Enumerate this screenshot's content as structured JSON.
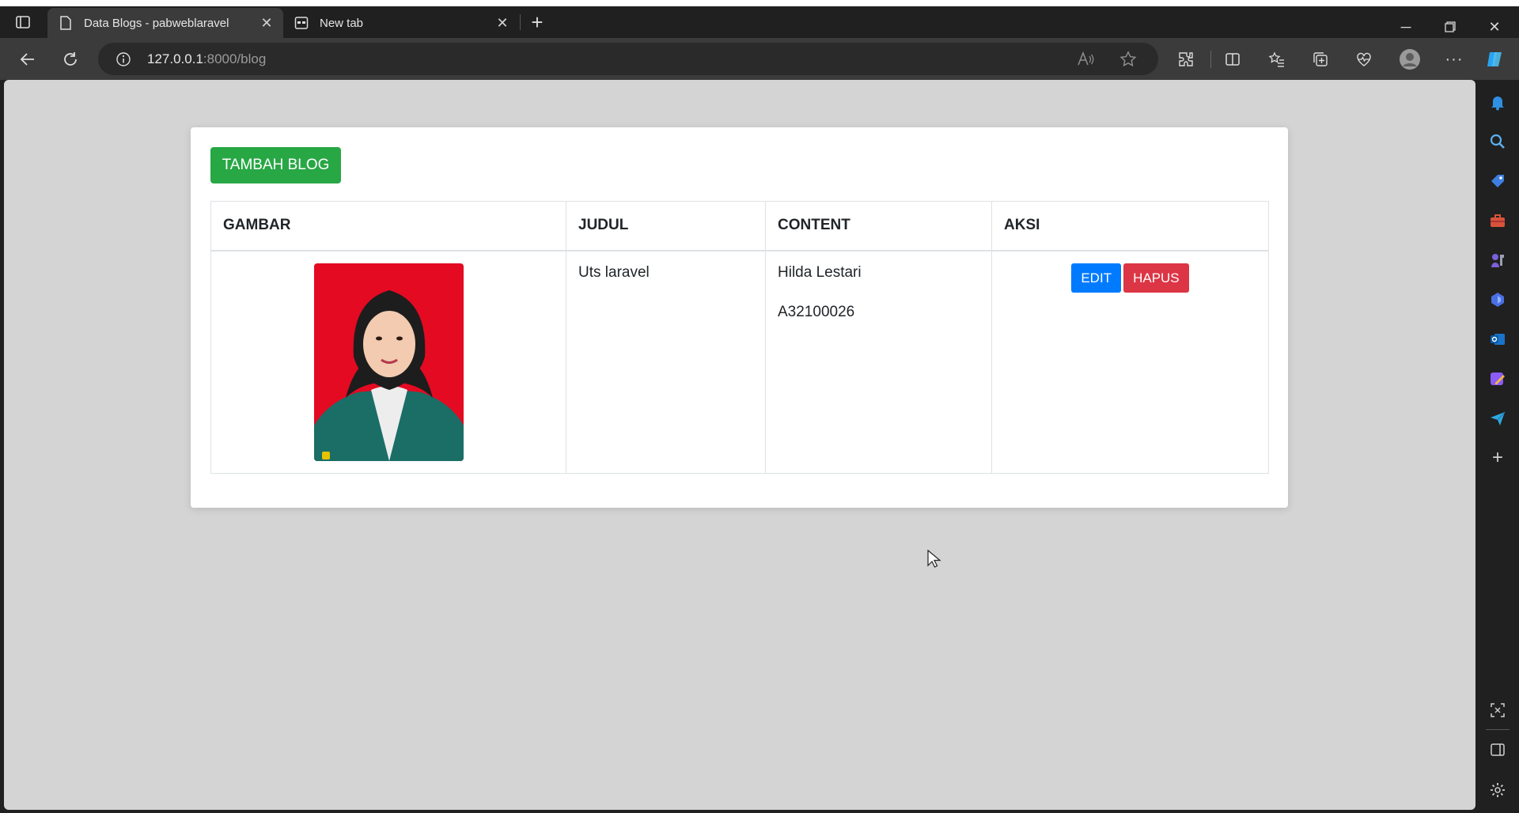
{
  "browser": {
    "tabs": [
      {
        "label": "Data Blogs - pabweblaravel",
        "active": true
      },
      {
        "label": "New tab",
        "active": false
      }
    ],
    "address": {
      "host": "127.0.0.1",
      "path": ":8000/blog"
    }
  },
  "page": {
    "add_button": "TAMBAH BLOG",
    "table": {
      "headers": [
        "GAMBAR",
        "JUDUL",
        "CONTENT",
        "AKSI"
      ],
      "rows": [
        {
          "judul": "Uts laravel",
          "content_line1": "Hilda Lestari",
          "content_line2": "A32100026",
          "edit_label": "EDIT",
          "delete_label": "HAPUS"
        }
      ]
    }
  },
  "colors": {
    "add": "#28a745",
    "edit": "#007bff",
    "delete": "#dc3545",
    "photo_bg": "#e30a22"
  }
}
